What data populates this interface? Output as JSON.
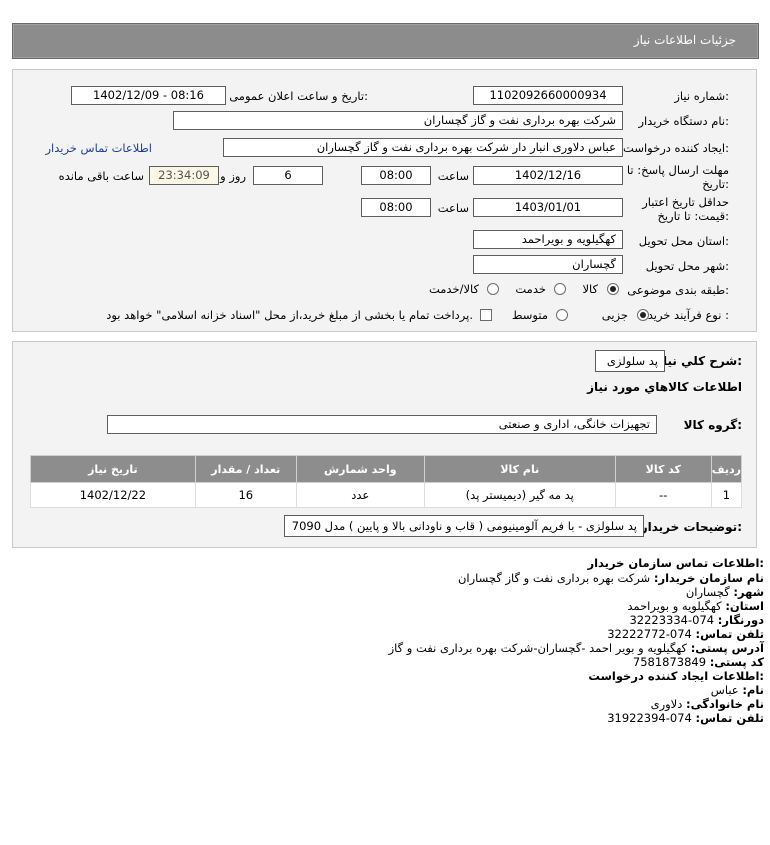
{
  "page": {
    "title": "جزئیات اطلاعات نیاز"
  },
  "form": {
    "need_number_label": "شماره نیاز:",
    "need_number": "1102092660000934",
    "announce_label": "تاریخ و ساعت اعلان عمومی:",
    "announce_value": "1402/12/09 - 08:16",
    "buyer_org_label": "نام دستگاه خریدار:",
    "buyer_org": "شرکت بهره برداری نفت و گاز گچساران",
    "creator_label": "ایجاد کننده درخواست:",
    "creator": "عباس دلاوری انبار دار شرکت بهره برداری نفت و گاز گچساران",
    "contact_link": "اطلاعات تماس خریدار",
    "deadline_label_1": "مهلت ارسال پاسخ: تا",
    "deadline_label_2": "تاریخ:",
    "deadline_date": "1402/12/16",
    "time_label": "ساعت",
    "deadline_time": "08:00",
    "days_value": "6",
    "days_label": "روز و",
    "remaining_time": "23:34:09",
    "remaining_label": "ساعت باقی مانده",
    "validity_label_1": "حداقل تاریخ اعتبار",
    "validity_label_2": "قیمت: تا تاریخ:",
    "validity_date": "1403/01/01",
    "validity_time": "08:00",
    "province_label": "استان محل تحویل:",
    "province": "کهگیلویه و بویراحمد",
    "city_label": "شهر محل تحویل:",
    "city": "گچساران",
    "category_label": "طبقه بندی موضوعی:",
    "category_goods": "کالا",
    "category_service": "خدمت",
    "category_both": "کالا/خدمت",
    "process_label": "نوع فرآیند خرید :",
    "process_partial": "جزیی",
    "process_medium": "متوسط",
    "payment_note": "پرداخت تمام یا بخشی از مبلغ خرید،از محل \"اسناد خزانه اسلامی\" خواهد بود."
  },
  "need": {
    "summary_label": "شرح كلي نياز:",
    "summary": "پد سلولزی",
    "goods_info_title": "اطلاعات كالاهاي مورد نياز",
    "group_label": "گروه كالا:",
    "group": "تجهیزات خانگی، اداری و صنعتی",
    "table": {
      "headers": [
        "ردیف",
        "کد کالا",
        "نام کالا",
        "واحد شمارش",
        "تعداد / مقدار",
        "تاریخ نیاز"
      ],
      "rows": [
        [
          "1",
          "--",
          "پد مه گیر (دیمیستر پد)",
          "عدد",
          "16",
          "1402/12/22"
        ]
      ]
    },
    "buyer_notes_label": "توضیحات خریدار:",
    "buyer_notes": "پد سلولزی - با فریم آلومینیومی ( قاب و ناودانی بالا و پایین ) مدل 7090"
  },
  "contact": {
    "title": "اطلاعات تماس سازمان خریدار:",
    "org_label": "نام سازمان خریدار:",
    "org": "شرکت بهره برداری نفت و گاز گچساران",
    "city_label": "شهر:",
    "city": "گچساران",
    "province_label": "استان:",
    "province": "کهگیلویه و بویراحمد",
    "fax_label": "دورنگار:",
    "fax": "074-32223334",
    "phone_label": "تلفن تماس:",
    "phone": "074-32222772",
    "address_label": "آدرس پستی:",
    "address": "کهگیلویه و بویر احمد -گچساران-شرکت بهره برداری نفت و گاز",
    "postal_label": "کد پستی:",
    "postal": "7581873849",
    "creator_title": "اطلاعات ایجاد کننده درخواست:",
    "name_label": "نام:",
    "name": "عباس",
    "family_label": "نام خانوادگی:",
    "family": "دلاوری",
    "creator_phone_label": "تلفن تماس:",
    "creator_phone": "074-31922394"
  },
  "colors": {
    "header_bg": "#8c8c8c",
    "panel_bg": "#f3f3f3",
    "link": "#1f3f9e",
    "table_header": "#8d8d8d"
  }
}
